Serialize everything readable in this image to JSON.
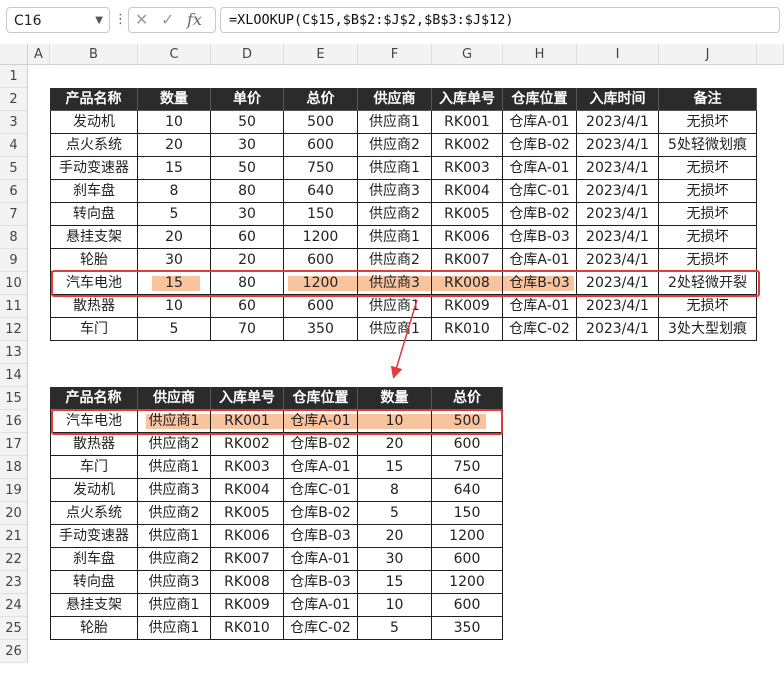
{
  "formula_bar": {
    "name_box": "C16",
    "formula": "=XLOOKUP(C$15,$B$2:$J$2,$B$3:$J$12)",
    "icons": [
      "cancel-icon",
      "confirm-icon",
      "fx-icon"
    ]
  },
  "columns": [
    "A",
    "B",
    "C",
    "D",
    "E",
    "F",
    "G",
    "H",
    "I",
    "J"
  ],
  "rows": [
    "1",
    "2",
    "3",
    "4",
    "5",
    "6",
    "7",
    "8",
    "9",
    "10",
    "11",
    "12",
    "13",
    "14",
    "15",
    "16",
    "17",
    "18",
    "19",
    "20",
    "21",
    "22",
    "23",
    "24",
    "25",
    "26"
  ],
  "table1": {
    "headers": [
      "产品名称",
      "数量",
      "单价",
      "总价",
      "供应商",
      "入库单号",
      "仓库位置",
      "入库时间",
      "备注"
    ],
    "rows": [
      [
        "发动机",
        "10",
        "50",
        "500",
        "供应商1",
        "RK001",
        "仓库A-01",
        "2023/4/1",
        "无损坏"
      ],
      [
        "点火系统",
        "20",
        "30",
        "600",
        "供应商2",
        "RK002",
        "仓库B-02",
        "2023/4/1",
        "5处轻微划痕"
      ],
      [
        "手动变速器",
        "15",
        "50",
        "750",
        "供应商1",
        "RK003",
        "仓库A-01",
        "2023/4/1",
        "无损坏"
      ],
      [
        "刹车盘",
        "8",
        "80",
        "640",
        "供应商3",
        "RK004",
        "仓库C-01",
        "2023/4/1",
        "无损坏"
      ],
      [
        "转向盘",
        "5",
        "30",
        "150",
        "供应商2",
        "RK005",
        "仓库B-02",
        "2023/4/1",
        "无损坏"
      ],
      [
        "悬挂支架",
        "20",
        "60",
        "1200",
        "供应商1",
        "RK006",
        "仓库B-03",
        "2023/4/1",
        "无损坏"
      ],
      [
        "轮胎",
        "30",
        "20",
        "600",
        "供应商2",
        "RK007",
        "仓库A-01",
        "2023/4/1",
        "无损坏"
      ],
      [
        "汽车电池",
        "15",
        "80",
        "1200",
        "供应商3",
        "RK008",
        "仓库B-03",
        "2023/4/1",
        "2处轻微开裂"
      ],
      [
        "散热器",
        "10",
        "60",
        "600",
        "供应商1",
        "RK009",
        "仓库A-01",
        "2023/4/1",
        "无损坏"
      ],
      [
        "车门",
        "5",
        "70",
        "350",
        "供应商1",
        "RK010",
        "仓库C-02",
        "2023/4/1",
        "3处大型划痕"
      ]
    ]
  },
  "table2": {
    "headers": [
      "产品名称",
      "供应商",
      "入库单号",
      "仓库位置",
      "数量",
      "总价"
    ],
    "rows": [
      [
        "汽车电池",
        "供应商1",
        "RK001",
        "仓库A-01",
        "10",
        "500"
      ],
      [
        "散热器",
        "供应商2",
        "RK002",
        "仓库B-02",
        "20",
        "600"
      ],
      [
        "车门",
        "供应商1",
        "RK003",
        "仓库A-01",
        "15",
        "750"
      ],
      [
        "发动机",
        "供应商3",
        "RK004",
        "仓库C-01",
        "8",
        "640"
      ],
      [
        "点火系统",
        "供应商2",
        "RK005",
        "仓库B-02",
        "5",
        "150"
      ],
      [
        "手动变速器",
        "供应商1",
        "RK006",
        "仓库B-03",
        "20",
        "1200"
      ],
      [
        "刹车盘",
        "供应商2",
        "RK007",
        "仓库A-01",
        "30",
        "600"
      ],
      [
        "转向盘",
        "供应商3",
        "RK008",
        "仓库B-03",
        "15",
        "1200"
      ],
      [
        "悬挂支架",
        "供应商1",
        "RK009",
        "仓库A-01",
        "10",
        "600"
      ],
      [
        "轮胎",
        "供应商1",
        "RK010",
        "仓库C-02",
        "5",
        "350"
      ]
    ]
  },
  "colors": {
    "header_bg": "#2b2b2b",
    "highlight": "#f8c4a0",
    "annotation": "#e23b3b"
  }
}
